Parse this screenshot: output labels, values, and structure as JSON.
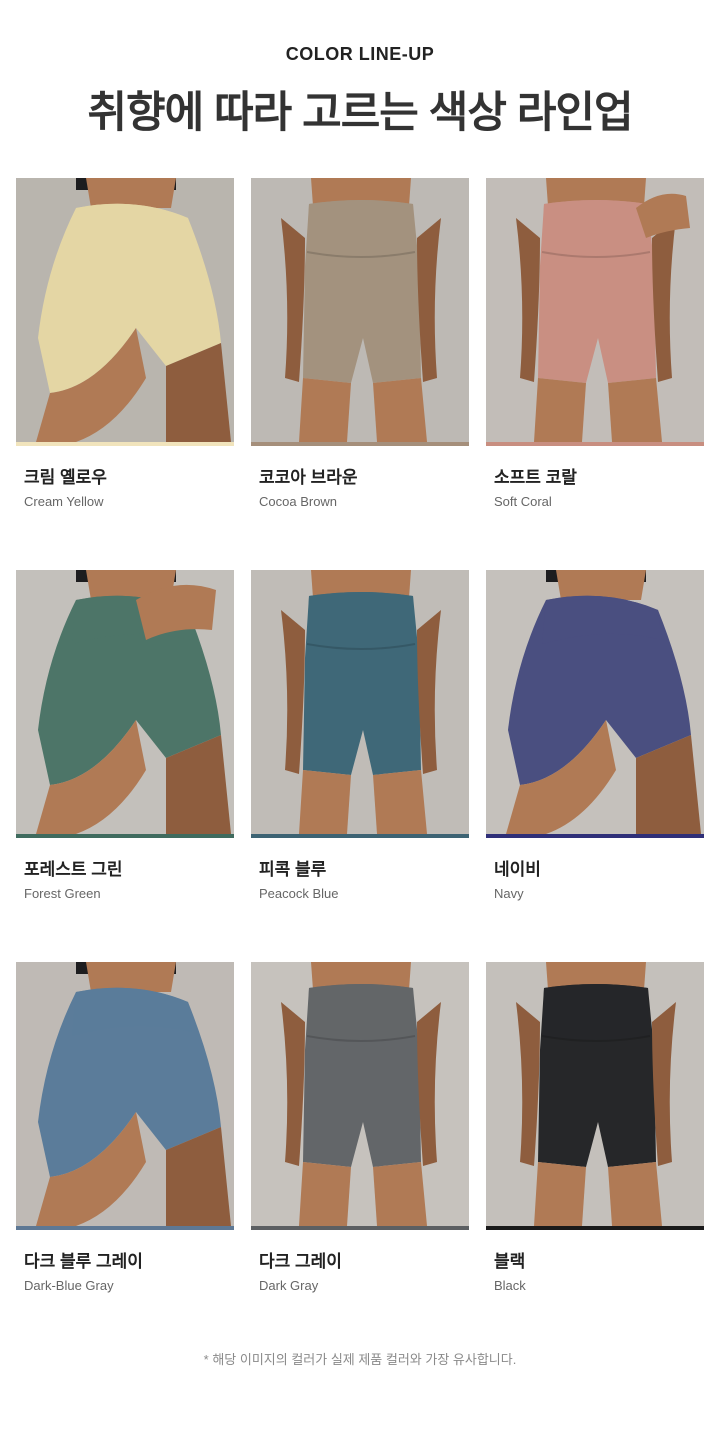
{
  "header": {
    "eyebrow": "COLOR LINE-UP",
    "title": "취향에 따라 고르는 색상 라인업"
  },
  "products": [
    {
      "name_ko": "크림 옐로우",
      "name_en": "Cream Yellow",
      "color": "#e4d6a4",
      "bar": "#f1e4bc",
      "bg": "#b9b5ae",
      "pose": "side"
    },
    {
      "name_ko": "코코아 브라운",
      "name_en": "Cocoa Brown",
      "color": "#a3927e",
      "bar": "#a58f7b",
      "bg": "#bdb9b4",
      "pose": "front"
    },
    {
      "name_ko": "소프트 코랄",
      "name_en": "Soft Coral",
      "color": "#c98f82",
      "bar": "#c88e80",
      "bg": "#c2bdb8",
      "pose": "front-hand"
    },
    {
      "name_ko": "포레스트 그린",
      "name_en": "Forest Green",
      "color": "#4d7568",
      "bar": "#3f6b5e",
      "bg": "#c3c0bb",
      "pose": "side-hand"
    },
    {
      "name_ko": "피콕 블루",
      "name_en": "Peacock Blue",
      "color": "#3f6878",
      "bar": "#3d6373",
      "bg": "#c0bcb7",
      "pose": "front"
    },
    {
      "name_ko": "네이비",
      "name_en": "Navy",
      "color": "#4a4f80",
      "bar": "#2f2f78",
      "bg": "#c5c1bc",
      "pose": "side"
    },
    {
      "name_ko": "다크 블루 그레이",
      "name_en": "Dark-Blue Gray",
      "color": "#5b7c9a",
      "bar": "#5e7894",
      "bg": "#bfbab5",
      "pose": "side"
    },
    {
      "name_ko": "다크 그레이",
      "name_en": "Dark Gray",
      "color": "#636669",
      "bar": "#5c5f62",
      "bg": "#c6c2bd",
      "pose": "front"
    },
    {
      "name_ko": "블랙",
      "name_en": "Black",
      "color": "#262729",
      "bar": "#1a1a1a",
      "bg": "#c4c0bb",
      "pose": "front"
    }
  ],
  "footer": {
    "note": "* 해당 이미지의 컬러가 실제 제품 컬러와 가장 유사합니다."
  }
}
